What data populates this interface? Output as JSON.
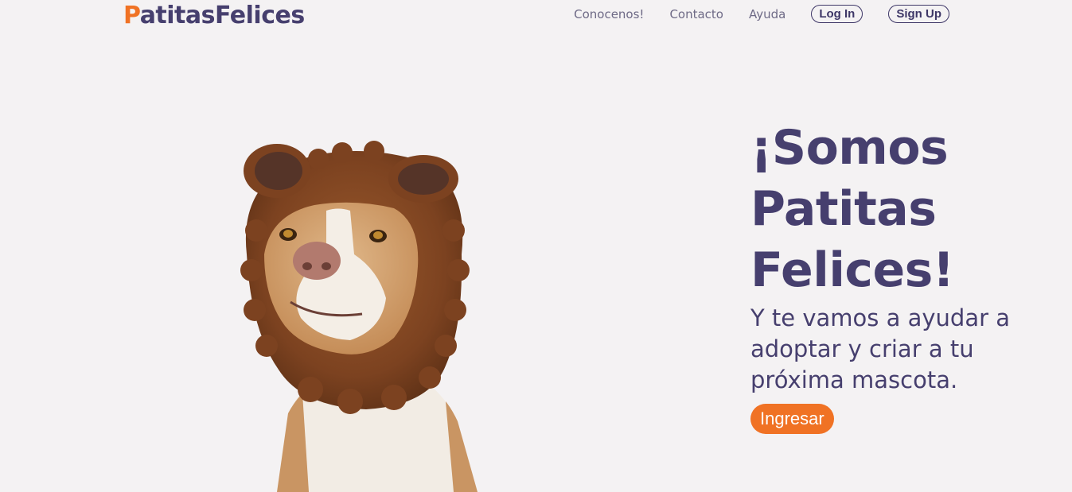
{
  "header": {
    "logo_initial": "P",
    "logo_rest": "atitasFelices",
    "nav": [
      "Conocenos!",
      "Contacto",
      "Ayuda"
    ],
    "login_label": "Log In",
    "signup_label": "Sign Up"
  },
  "hero": {
    "title_line1": "¡Somos",
    "title_line2": "Patitas",
    "title_line3": "Felices!",
    "subtitle_line1": "Y te vamos a ayudar a",
    "subtitle_line2": "adoptar y criar a tu",
    "subtitle_line3": "próxima mascota.",
    "cta_label": "Ingresar"
  },
  "colors": {
    "background": "#f4f2f3",
    "primary_text": "#463f6e",
    "accent": "#f07224",
    "nav_text": "#6e6a86"
  }
}
